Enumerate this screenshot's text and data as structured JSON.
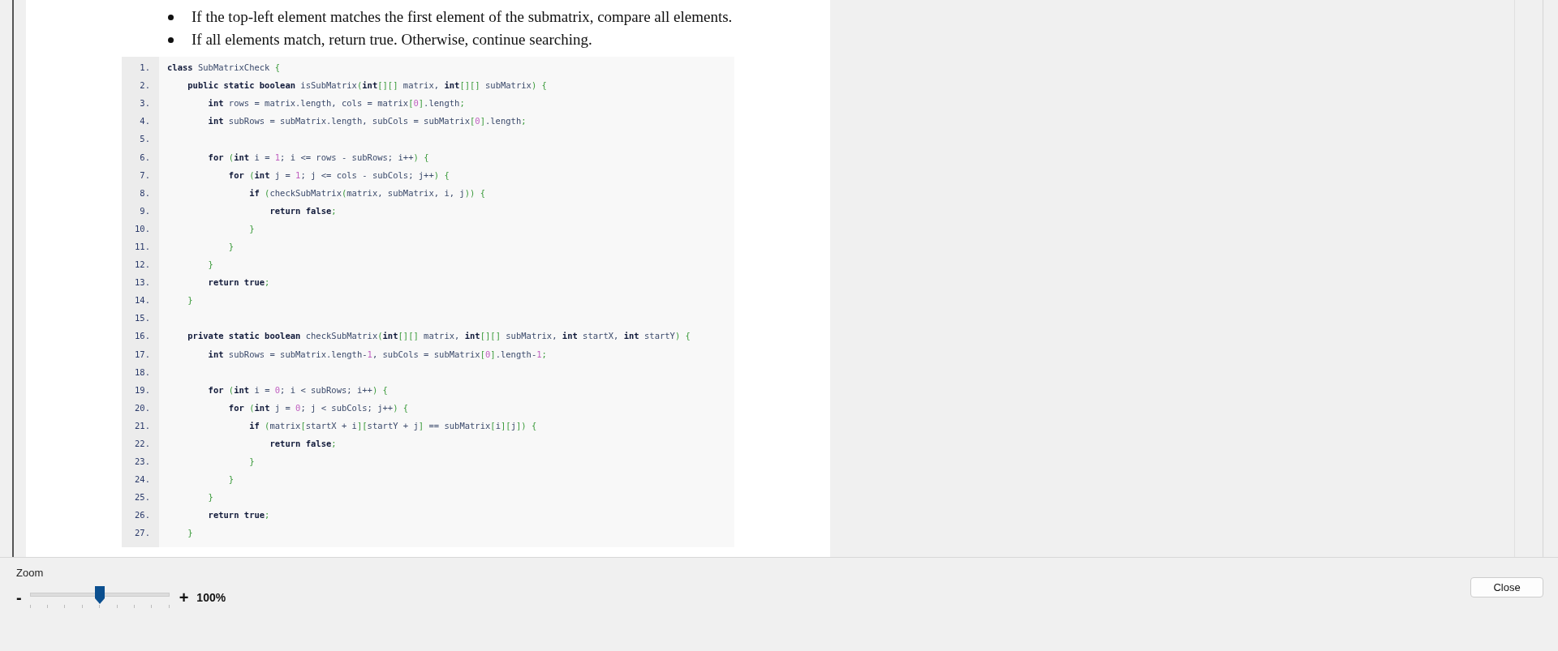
{
  "bullets": [
    "If the top-left element matches the first element of the submatrix, compare all elements.",
    "If all elements match, return true. Otherwise, continue searching."
  ],
  "code": [
    {
      "number": "1.",
      "tokens": [
        {
          "text": "class",
          "kind": "kw"
        },
        {
          "text": " SubMatrixCheck ",
          "kind": "id"
        },
        {
          "text": "{",
          "kind": "p"
        }
      ]
    },
    {
      "number": "2.",
      "tokens": [
        {
          "text": "    public static boolean",
          "kind": "kw"
        },
        {
          "text": " isSubMatrix",
          "kind": "id"
        },
        {
          "text": "(",
          "kind": "p"
        },
        {
          "text": "int",
          "kind": "kw"
        },
        {
          "text": "[][]",
          "kind": "p"
        },
        {
          "text": " matrix, ",
          "kind": "id"
        },
        {
          "text": "int",
          "kind": "kw"
        },
        {
          "text": "[][]",
          "kind": "p"
        },
        {
          "text": " subMatrix",
          "kind": "id"
        },
        {
          "text": ") {",
          "kind": "p"
        }
      ]
    },
    {
      "number": "3.",
      "tokens": [
        {
          "text": "        int",
          "kind": "kw"
        },
        {
          "text": " rows = matrix.length, cols = matrix",
          "kind": "id"
        },
        {
          "text": "[",
          "kind": "p"
        },
        {
          "text": "0",
          "kind": "n"
        },
        {
          "text": "]",
          "kind": "p"
        },
        {
          "text": ".length",
          "kind": "id"
        },
        {
          "text": ";",
          "kind": "p"
        }
      ]
    },
    {
      "number": "4.",
      "tokens": [
        {
          "text": "        int",
          "kind": "kw"
        },
        {
          "text": " subRows = subMatrix.length, subCols = subMatrix",
          "kind": "id"
        },
        {
          "text": "[",
          "kind": "p"
        },
        {
          "text": "0",
          "kind": "n"
        },
        {
          "text": "]",
          "kind": "p"
        },
        {
          "text": ".length",
          "kind": "id"
        },
        {
          "text": ";",
          "kind": "p"
        }
      ]
    },
    {
      "number": "5."
    },
    {
      "number": "6.",
      "tokens": [
        {
          "text": "        for",
          "kind": "kw"
        },
        {
          "text": " (",
          "kind": "p"
        },
        {
          "text": "int",
          "kind": "kw"
        },
        {
          "text": " i = ",
          "kind": "id"
        },
        {
          "text": "1",
          "kind": "n"
        },
        {
          "text": "; i <= rows - subRows; i++",
          "kind": "id"
        },
        {
          "text": ") {",
          "kind": "p"
        }
      ]
    },
    {
      "number": "7.",
      "tokens": [
        {
          "text": "            for",
          "kind": "kw"
        },
        {
          "text": " (",
          "kind": "p"
        },
        {
          "text": "int",
          "kind": "kw"
        },
        {
          "text": " j = ",
          "kind": "id"
        },
        {
          "text": "1",
          "kind": "n"
        },
        {
          "text": "; j <= cols - subCols; j++",
          "kind": "id"
        },
        {
          "text": ") {",
          "kind": "p"
        }
      ]
    },
    {
      "number": "8.",
      "tokens": [
        {
          "text": "                if",
          "kind": "kw"
        },
        {
          "text": " (",
          "kind": "p"
        },
        {
          "text": "checkSubMatrix",
          "kind": "id"
        },
        {
          "text": "(",
          "kind": "p"
        },
        {
          "text": "matrix, subMatrix, i, j",
          "kind": "id"
        },
        {
          "text": ")) {",
          "kind": "p"
        }
      ]
    },
    {
      "number": "9.",
      "tokens": [
        {
          "text": "                    return false",
          "kind": "kw"
        },
        {
          "text": ";",
          "kind": "p"
        }
      ]
    },
    {
      "number": "10.",
      "tokens": [
        {
          "text": "                }",
          "kind": "p"
        }
      ]
    },
    {
      "number": "11.",
      "tokens": [
        {
          "text": "            }",
          "kind": "p"
        }
      ]
    },
    {
      "number": "12.",
      "tokens": [
        {
          "text": "        }",
          "kind": "p"
        }
      ]
    },
    {
      "number": "13.",
      "tokens": [
        {
          "text": "        return true",
          "kind": "kw"
        },
        {
          "text": ";",
          "kind": "p"
        }
      ]
    },
    {
      "number": "14.",
      "tokens": [
        {
          "text": "    }",
          "kind": "p"
        }
      ]
    },
    {
      "number": "15."
    },
    {
      "number": "16.",
      "tokens": [
        {
          "text": "    private static boolean",
          "kind": "kw"
        },
        {
          "text": " checkSubMatrix",
          "kind": "id"
        },
        {
          "text": "(",
          "kind": "p"
        },
        {
          "text": "int",
          "kind": "kw"
        },
        {
          "text": "[][]",
          "kind": "p"
        },
        {
          "text": " matrix, ",
          "kind": "id"
        },
        {
          "text": "int",
          "kind": "kw"
        },
        {
          "text": "[][]",
          "kind": "p"
        },
        {
          "text": " subMatrix, ",
          "kind": "id"
        },
        {
          "text": "int",
          "kind": "kw"
        },
        {
          "text": " startX, ",
          "kind": "id"
        },
        {
          "text": "int",
          "kind": "kw"
        },
        {
          "text": " startY",
          "kind": "id"
        },
        {
          "text": ") {",
          "kind": "p"
        }
      ]
    },
    {
      "number": "17.",
      "tokens": [
        {
          "text": "        int",
          "kind": "kw"
        },
        {
          "text": " subRows = subMatrix.length-",
          "kind": "id"
        },
        {
          "text": "1",
          "kind": "n"
        },
        {
          "text": ", subCols = subMatrix",
          "kind": "id"
        },
        {
          "text": "[",
          "kind": "p"
        },
        {
          "text": "0",
          "kind": "n"
        },
        {
          "text": "]",
          "kind": "p"
        },
        {
          "text": ".length-",
          "kind": "id"
        },
        {
          "text": "1",
          "kind": "n"
        },
        {
          "text": ";",
          "kind": "p"
        }
      ]
    },
    {
      "number": "18."
    },
    {
      "number": "19.",
      "tokens": [
        {
          "text": "        for",
          "kind": "kw"
        },
        {
          "text": " (",
          "kind": "p"
        },
        {
          "text": "int",
          "kind": "kw"
        },
        {
          "text": " i = ",
          "kind": "id"
        },
        {
          "text": "0",
          "kind": "n"
        },
        {
          "text": "; i < subRows; i++",
          "kind": "id"
        },
        {
          "text": ") {",
          "kind": "p"
        }
      ]
    },
    {
      "number": "20.",
      "tokens": [
        {
          "text": "            for",
          "kind": "kw"
        },
        {
          "text": " (",
          "kind": "p"
        },
        {
          "text": "int",
          "kind": "kw"
        },
        {
          "text": " j = ",
          "kind": "id"
        },
        {
          "text": "0",
          "kind": "n"
        },
        {
          "text": "; j < subCols; j++",
          "kind": "id"
        },
        {
          "text": ") {",
          "kind": "p"
        }
      ]
    },
    {
      "number": "21.",
      "tokens": [
        {
          "text": "                if",
          "kind": "kw"
        },
        {
          "text": " (",
          "kind": "p"
        },
        {
          "text": "matrix",
          "kind": "id"
        },
        {
          "text": "[",
          "kind": "p"
        },
        {
          "text": "startX + i",
          "kind": "id"
        },
        {
          "text": "][",
          "kind": "p"
        },
        {
          "text": "startY + j",
          "kind": "id"
        },
        {
          "text": "]",
          "kind": "p"
        },
        {
          "text": " == subMatrix",
          "kind": "id"
        },
        {
          "text": "[",
          "kind": "p"
        },
        {
          "text": "i",
          "kind": "id"
        },
        {
          "text": "][",
          "kind": "p"
        },
        {
          "text": "j",
          "kind": "id"
        },
        {
          "text": "]) {",
          "kind": "p"
        }
      ]
    },
    {
      "number": "22.",
      "tokens": [
        {
          "text": "                    return false",
          "kind": "kw"
        },
        {
          "text": ";",
          "kind": "p"
        }
      ]
    },
    {
      "number": "23.",
      "tokens": [
        {
          "text": "                }",
          "kind": "p"
        }
      ]
    },
    {
      "number": "24.",
      "tokens": [
        {
          "text": "            }",
          "kind": "p"
        }
      ]
    },
    {
      "number": "25.",
      "tokens": [
        {
          "text": "        }",
          "kind": "p"
        }
      ]
    },
    {
      "number": "26.",
      "tokens": [
        {
          "text": "        return true",
          "kind": "kw"
        },
        {
          "text": ";",
          "kind": "p"
        }
      ]
    },
    {
      "number": "27.",
      "tokens": [
        {
          "text": "    }",
          "kind": "p"
        }
      ]
    }
  ],
  "zoom": {
    "label": "Zoom",
    "minus": "-",
    "plus": "+",
    "level": 0.5,
    "reading": "100%"
  },
  "buttons": [
    "Close"
  ]
}
